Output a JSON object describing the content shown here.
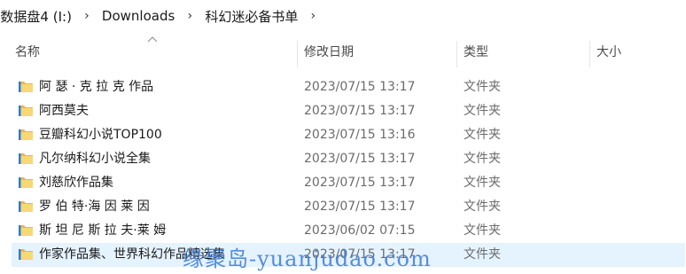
{
  "breadcrumb": {
    "items": [
      "I数据盘4 (I:)",
      "Downloads",
      "科幻迷必备书单"
    ],
    "separator": "›"
  },
  "columns": {
    "name": "名称",
    "date": "修改日期",
    "type": "类型",
    "size": "大小"
  },
  "rows": [
    {
      "name": "阿 瑟 · 克 拉 克 作品",
      "date": "2023/07/15 13:17",
      "type": "文件夹"
    },
    {
      "name": "阿西莫夫",
      "date": "2023/07/15 13:17",
      "type": "文件夹"
    },
    {
      "name": "豆瓣科幻小说TOP100",
      "date": "2023/07/15 13:16",
      "type": "文件夹"
    },
    {
      "name": "凡尔纳科幻小说全集",
      "date": "2023/07/15 13:17",
      "type": "文件夹"
    },
    {
      "name": "刘慈欣作品集",
      "date": "2023/07/15 13:17",
      "type": "文件夹"
    },
    {
      "name": "罗 伯 特·海 因 莱 因",
      "date": "2023/07/15 13:17",
      "type": "文件夹"
    },
    {
      "name": "斯 坦 尼 斯 拉 夫·莱 姆",
      "date": "2023/06/02 07:15",
      "type": "文件夹"
    },
    {
      "name": "作家作品集、世界科幻作品精选集",
      "date": "2023/07/15 13:17",
      "type": "文件夹"
    }
  ],
  "watermark": "缘聚岛-yuanjudao.com",
  "colors": {
    "folder": "#f8d775",
    "folder_dark": "#e8b84a",
    "folder_accent": "#2f7bd6",
    "selected_row": "#e5f3ff"
  },
  "icons": {
    "folder": "folder-icon",
    "separator": "chevron-right-icon",
    "sort": "sort-ascending-icon"
  }
}
